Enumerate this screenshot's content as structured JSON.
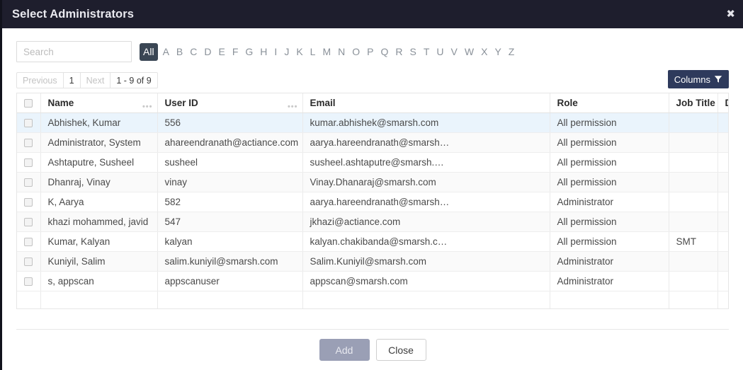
{
  "modal": {
    "title": "Select Administrators",
    "close_icon": "close-icon",
    "close_glyph": "✖"
  },
  "colors": {
    "title_bar": "#1e1e2d",
    "alpha_active": "#3a4654",
    "columns_button": "#2e3a5c",
    "row_highlight": "#eaf4fc",
    "add_disabled": "#9a9fb5"
  },
  "search": {
    "placeholder": "Search",
    "value": ""
  },
  "alpha_filter": {
    "active": "All",
    "items": [
      "All",
      "A",
      "B",
      "C",
      "D",
      "E",
      "F",
      "G",
      "H",
      "I",
      "J",
      "K",
      "L",
      "M",
      "N",
      "O",
      "P",
      "Q",
      "R",
      "S",
      "T",
      "U",
      "V",
      "W",
      "X",
      "Y",
      "Z"
    ]
  },
  "pager": {
    "previous_label": "Previous",
    "page_label": "1",
    "next_label": "Next",
    "range_label": "1 - 9 of 9",
    "previous_disabled": true,
    "next_disabled": true
  },
  "columns_button": {
    "label": "Columns",
    "icon": "funnel-icon"
  },
  "table": {
    "select_all_checkbox": false,
    "headers": [
      {
        "label": "",
        "key": "checkbox",
        "grip": false
      },
      {
        "label": "Name",
        "key": "name",
        "grip": true
      },
      {
        "label": "User ID",
        "key": "user_id",
        "grip": true
      },
      {
        "label": "Email",
        "key": "email",
        "grip": false
      },
      {
        "label": "Role",
        "key": "role",
        "grip": false
      },
      {
        "label": "Job Title",
        "key": "job_title",
        "grip": false
      },
      {
        "label": "D",
        "key": "department",
        "grip": false
      }
    ],
    "rows": [
      {
        "selected": false,
        "highlighted": true,
        "name": "Abhishek, Kumar",
        "user_id": "556",
        "email": "kumar.abhishek@smarsh.com",
        "role": "All permission",
        "job_title": "",
        "department": ""
      },
      {
        "selected": false,
        "highlighted": false,
        "name": "Administrator, System",
        "user_id": "ahareendranath@actiance.com",
        "email": "aarya.hareendranath@smarsh…",
        "role": "All permission",
        "job_title": "",
        "department": ""
      },
      {
        "selected": false,
        "highlighted": false,
        "name": "Ashtaputre, Susheel",
        "user_id": "susheel",
        "email": "susheel.ashtaputre@smarsh.…",
        "role": "All permission",
        "job_title": "",
        "department": ""
      },
      {
        "selected": false,
        "highlighted": false,
        "name": "Dhanraj, Vinay",
        "user_id": "vinay",
        "email": "Vinay.Dhanaraj@smarsh.com",
        "role": "All permission",
        "job_title": "",
        "department": ""
      },
      {
        "selected": false,
        "highlighted": false,
        "name": "K, Aarya",
        "user_id": "582",
        "email": "aarya.hareendranath@smarsh…",
        "role": "Administrator",
        "job_title": "",
        "department": ""
      },
      {
        "selected": false,
        "highlighted": false,
        "name": "khazi mohammed, javid",
        "user_id": "547",
        "email": "jkhazi@actiance.com",
        "role": "All permission",
        "job_title": "",
        "department": ""
      },
      {
        "selected": false,
        "highlighted": false,
        "name": "Kumar, Kalyan",
        "user_id": "kalyan",
        "email": "kalyan.chakibanda@smarsh.c…",
        "role": "All permission",
        "job_title": "SMT",
        "department": ""
      },
      {
        "selected": false,
        "highlighted": false,
        "name": "Kuniyil, Salim",
        "user_id": "salim.kuniyil@smarsh.com",
        "email": "Salim.Kuniyil@smarsh.com",
        "role": "Administrator",
        "job_title": "",
        "department": ""
      },
      {
        "selected": false,
        "highlighted": false,
        "name": "s, appscan",
        "user_id": "appscanuser",
        "email": "appscan@smarsh.com",
        "role": "Administrator",
        "job_title": "",
        "department": ""
      }
    ]
  },
  "footer": {
    "add_label": "Add",
    "add_disabled": true,
    "close_label": "Close"
  }
}
